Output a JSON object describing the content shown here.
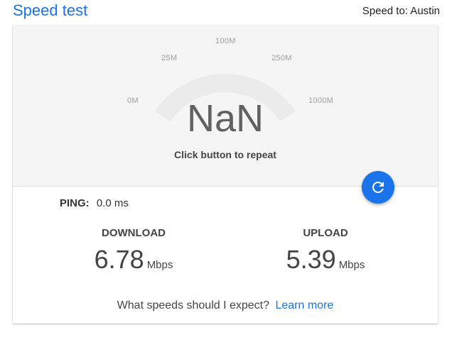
{
  "header": {
    "title": "Speed test",
    "server_label": "Speed to: Austin"
  },
  "gauge": {
    "ticks": [
      "0M",
      "25M",
      "100M",
      "250M",
      "1000M"
    ],
    "value": "NaN",
    "caption": "Click button to repeat",
    "track_color": "#ebebeb"
  },
  "repeat_button": {
    "icon": "refresh-icon",
    "color": "#1a73e8"
  },
  "ping": {
    "label": "PING:",
    "value": "0.0 ms"
  },
  "download": {
    "label": "DOWNLOAD",
    "value": "6.78",
    "unit": "Mbps"
  },
  "upload": {
    "label": "UPLOAD",
    "value": "5.39",
    "unit": "Mbps"
  },
  "footer": {
    "question": "What speeds should I expect?",
    "link_label": "Learn more"
  },
  "colors": {
    "accent": "#1a73e8",
    "panel_bg": "#f5f5f5"
  }
}
